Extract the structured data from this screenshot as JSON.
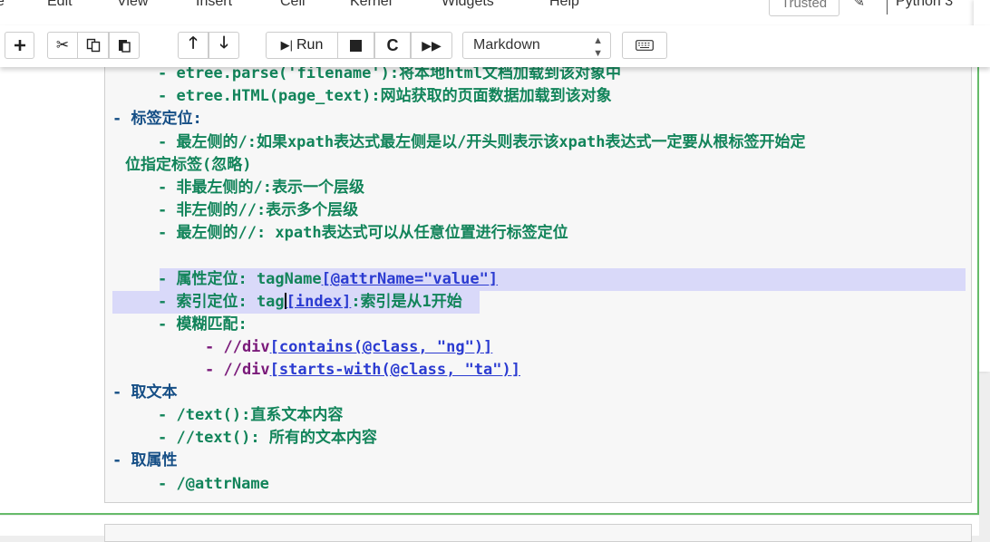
{
  "menubar": {
    "items": [
      "e",
      "Edit",
      "View",
      "Insert",
      "Cell",
      "Kernel",
      "Widgets",
      "Help"
    ],
    "trusted_label": "Trusted",
    "kernel_name": "Python 3"
  },
  "toolbar": {
    "add_icon": "plus-icon",
    "cut_icon": "scissors-icon",
    "copy_icon": "copy-icon",
    "paste_icon": "paste-icon",
    "run_label": "Run",
    "cell_type": "Markdown",
    "keyboard_icon": "keyboard-icon"
  },
  "cell": {
    "l1": "- etree.parse('filename'):将本地html文档加载到该对象中",
    "l2": "- etree.HTML(page_text):网站获取的页面数据加载到该对象",
    "l3": "- 标签定位:",
    "l4": "- 最左侧的/:如果xpath表达式最左侧是以/开头则表示该xpath表达式一定要从根标签开始定",
    "l4b": "位指定标签(忽略)",
    "l5": "- 非最左侧的/:表示一个层级",
    "l6": "- 非左侧的//:表示多个层级",
    "l7": "- 最左侧的//: xpath表达式可以从任意位置进行标签定位",
    "l8a": "- 属性定位: tagName",
    "l8b": "[@attrName=\"value\"]",
    "l9a": "- 索引定位: tag",
    "l9b": "[index]",
    "l9c": ":索引是从1开始",
    "l10": "- 模糊匹配:",
    "l11a": "- //div",
    "l11b": "[contains(@class, \"ng\")]",
    "l12a": "- //div",
    "l12b": "[starts-with(@class, \"ta\")]",
    "l13": "- 取文本",
    "l14": "- /text():直系文本内容",
    "l15": "- //text(): 所有的文本内容",
    "l16": "- 取属性",
    "l17": "- /@attrName"
  }
}
